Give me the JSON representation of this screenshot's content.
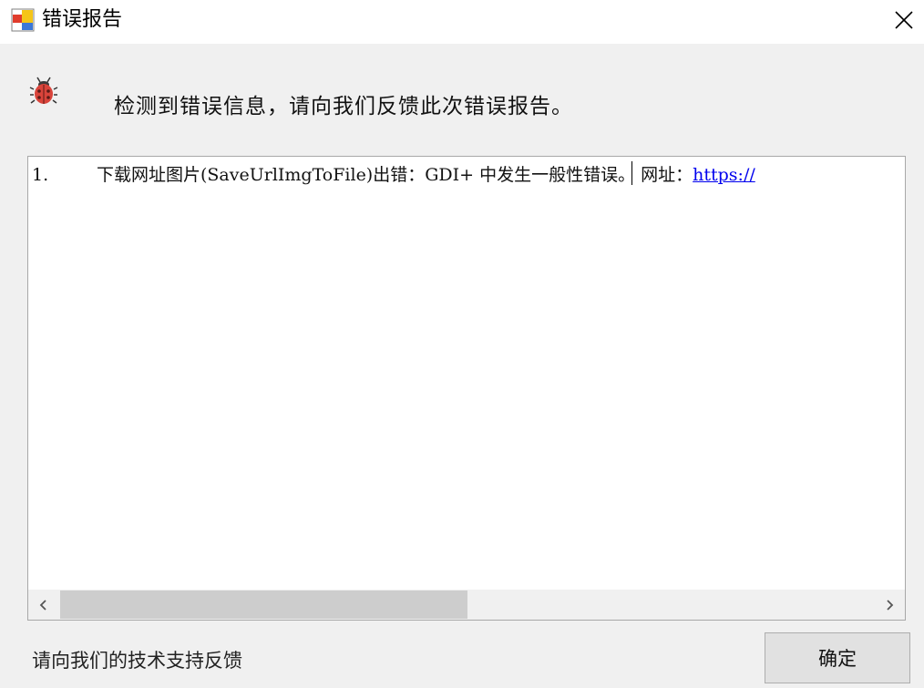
{
  "window": {
    "title": "错误报告"
  },
  "header": {
    "message": "检测到错误信息，请向我们反馈此次错误报告。"
  },
  "log": {
    "lines": [
      {
        "number": "1.",
        "text": "下载网址图片(SaveUrlImgToFile)出错：GDI+ 中发生一般性错误。 网址：",
        "url": "https://"
      }
    ]
  },
  "footer": {
    "support_text": "请向我们的技术支持反馈",
    "ok_label": "确定"
  },
  "colors": {
    "window_bg": "#f0f0f0",
    "link": "#0000ee",
    "button_bg": "#e1e1e1",
    "scroll_thumb": "#cdcdcd"
  },
  "icons": {
    "app": "app-window-icon",
    "close": "close-icon",
    "bug": "bug-icon",
    "scroll_left": "chevron-left-icon",
    "scroll_right": "chevron-right-icon"
  }
}
